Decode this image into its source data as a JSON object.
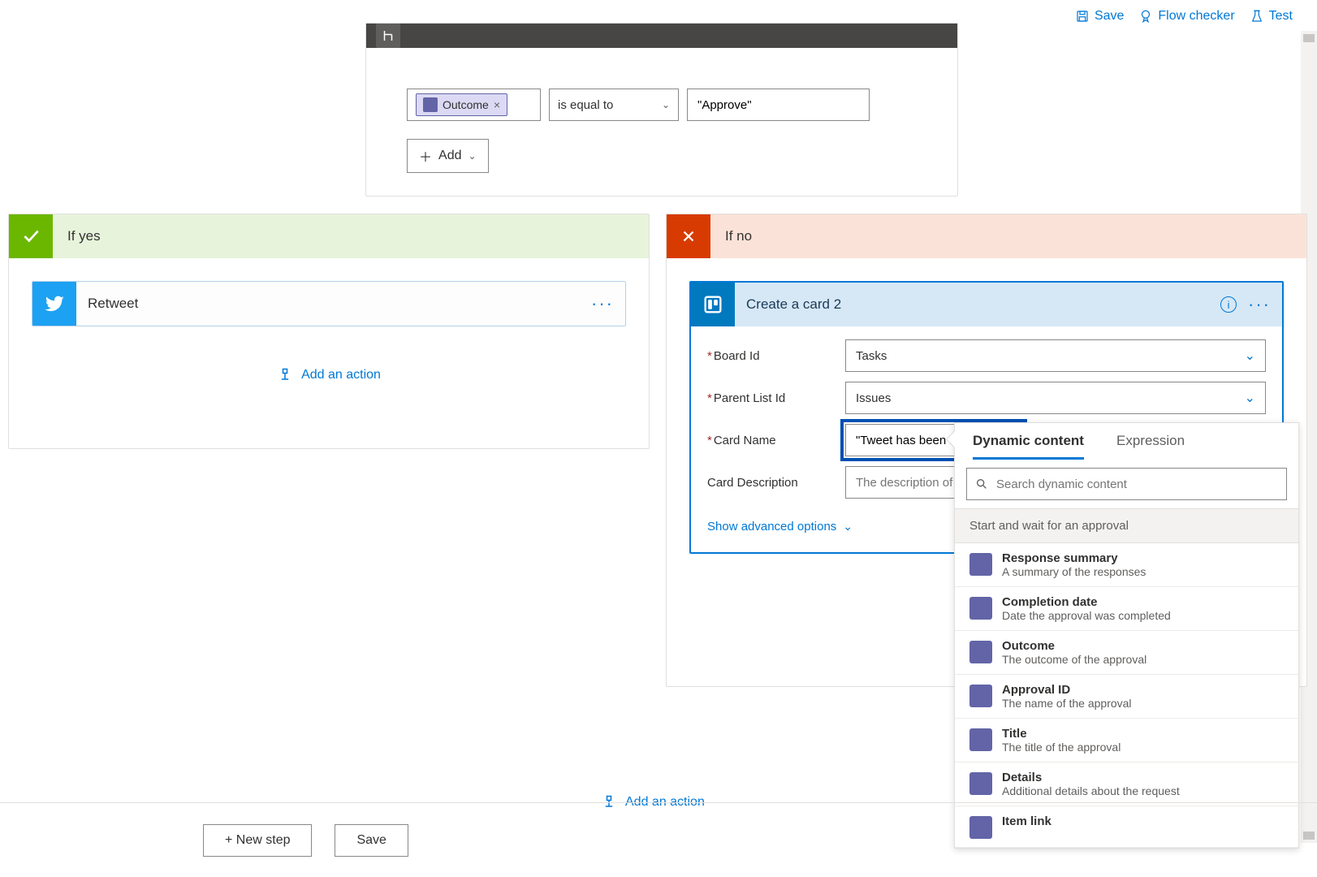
{
  "toolbar": {
    "save": "Save",
    "flow_checker": "Flow checker",
    "test": "Test"
  },
  "condition": {
    "token_label": "Outcome",
    "operator": "is equal to",
    "value": "\"Approve\"",
    "add_label": "Add"
  },
  "branches": {
    "yes_label": "If yes",
    "no_label": "If no"
  },
  "retweet": {
    "title": "Retweet"
  },
  "add_action_label": "Add an action",
  "create_card": {
    "title": "Create a card 2",
    "fields": {
      "board_id": {
        "label": "Board Id",
        "value": "Tasks"
      },
      "parent_list": {
        "label": "Parent List Id",
        "value": "Issues"
      },
      "card_name": {
        "label": "Card Name",
        "value": "\"Tweet has been rejected\""
      },
      "card_desc": {
        "label": "Card Description",
        "placeholder": "The description of the"
      }
    },
    "show_advanced": "Show advanced options"
  },
  "dynamic_content": {
    "tabs": {
      "dynamic": "Dynamic content",
      "expression": "Expression"
    },
    "search_placeholder": "Search dynamic content",
    "group": "Start and wait for an approval",
    "items": [
      {
        "title": "Response summary",
        "desc": "A summary of the responses"
      },
      {
        "title": "Completion date",
        "desc": "Date the approval was completed"
      },
      {
        "title": "Outcome",
        "desc": "The outcome of the approval"
      },
      {
        "title": "Approval ID",
        "desc": "The name of the approval"
      },
      {
        "title": "Title",
        "desc": "The title of the approval"
      },
      {
        "title": "Details",
        "desc": "Additional details about the request"
      },
      {
        "title": "Item link",
        "desc": ""
      }
    ]
  },
  "bottom": {
    "new_step": "+ New step",
    "save": "Save"
  }
}
